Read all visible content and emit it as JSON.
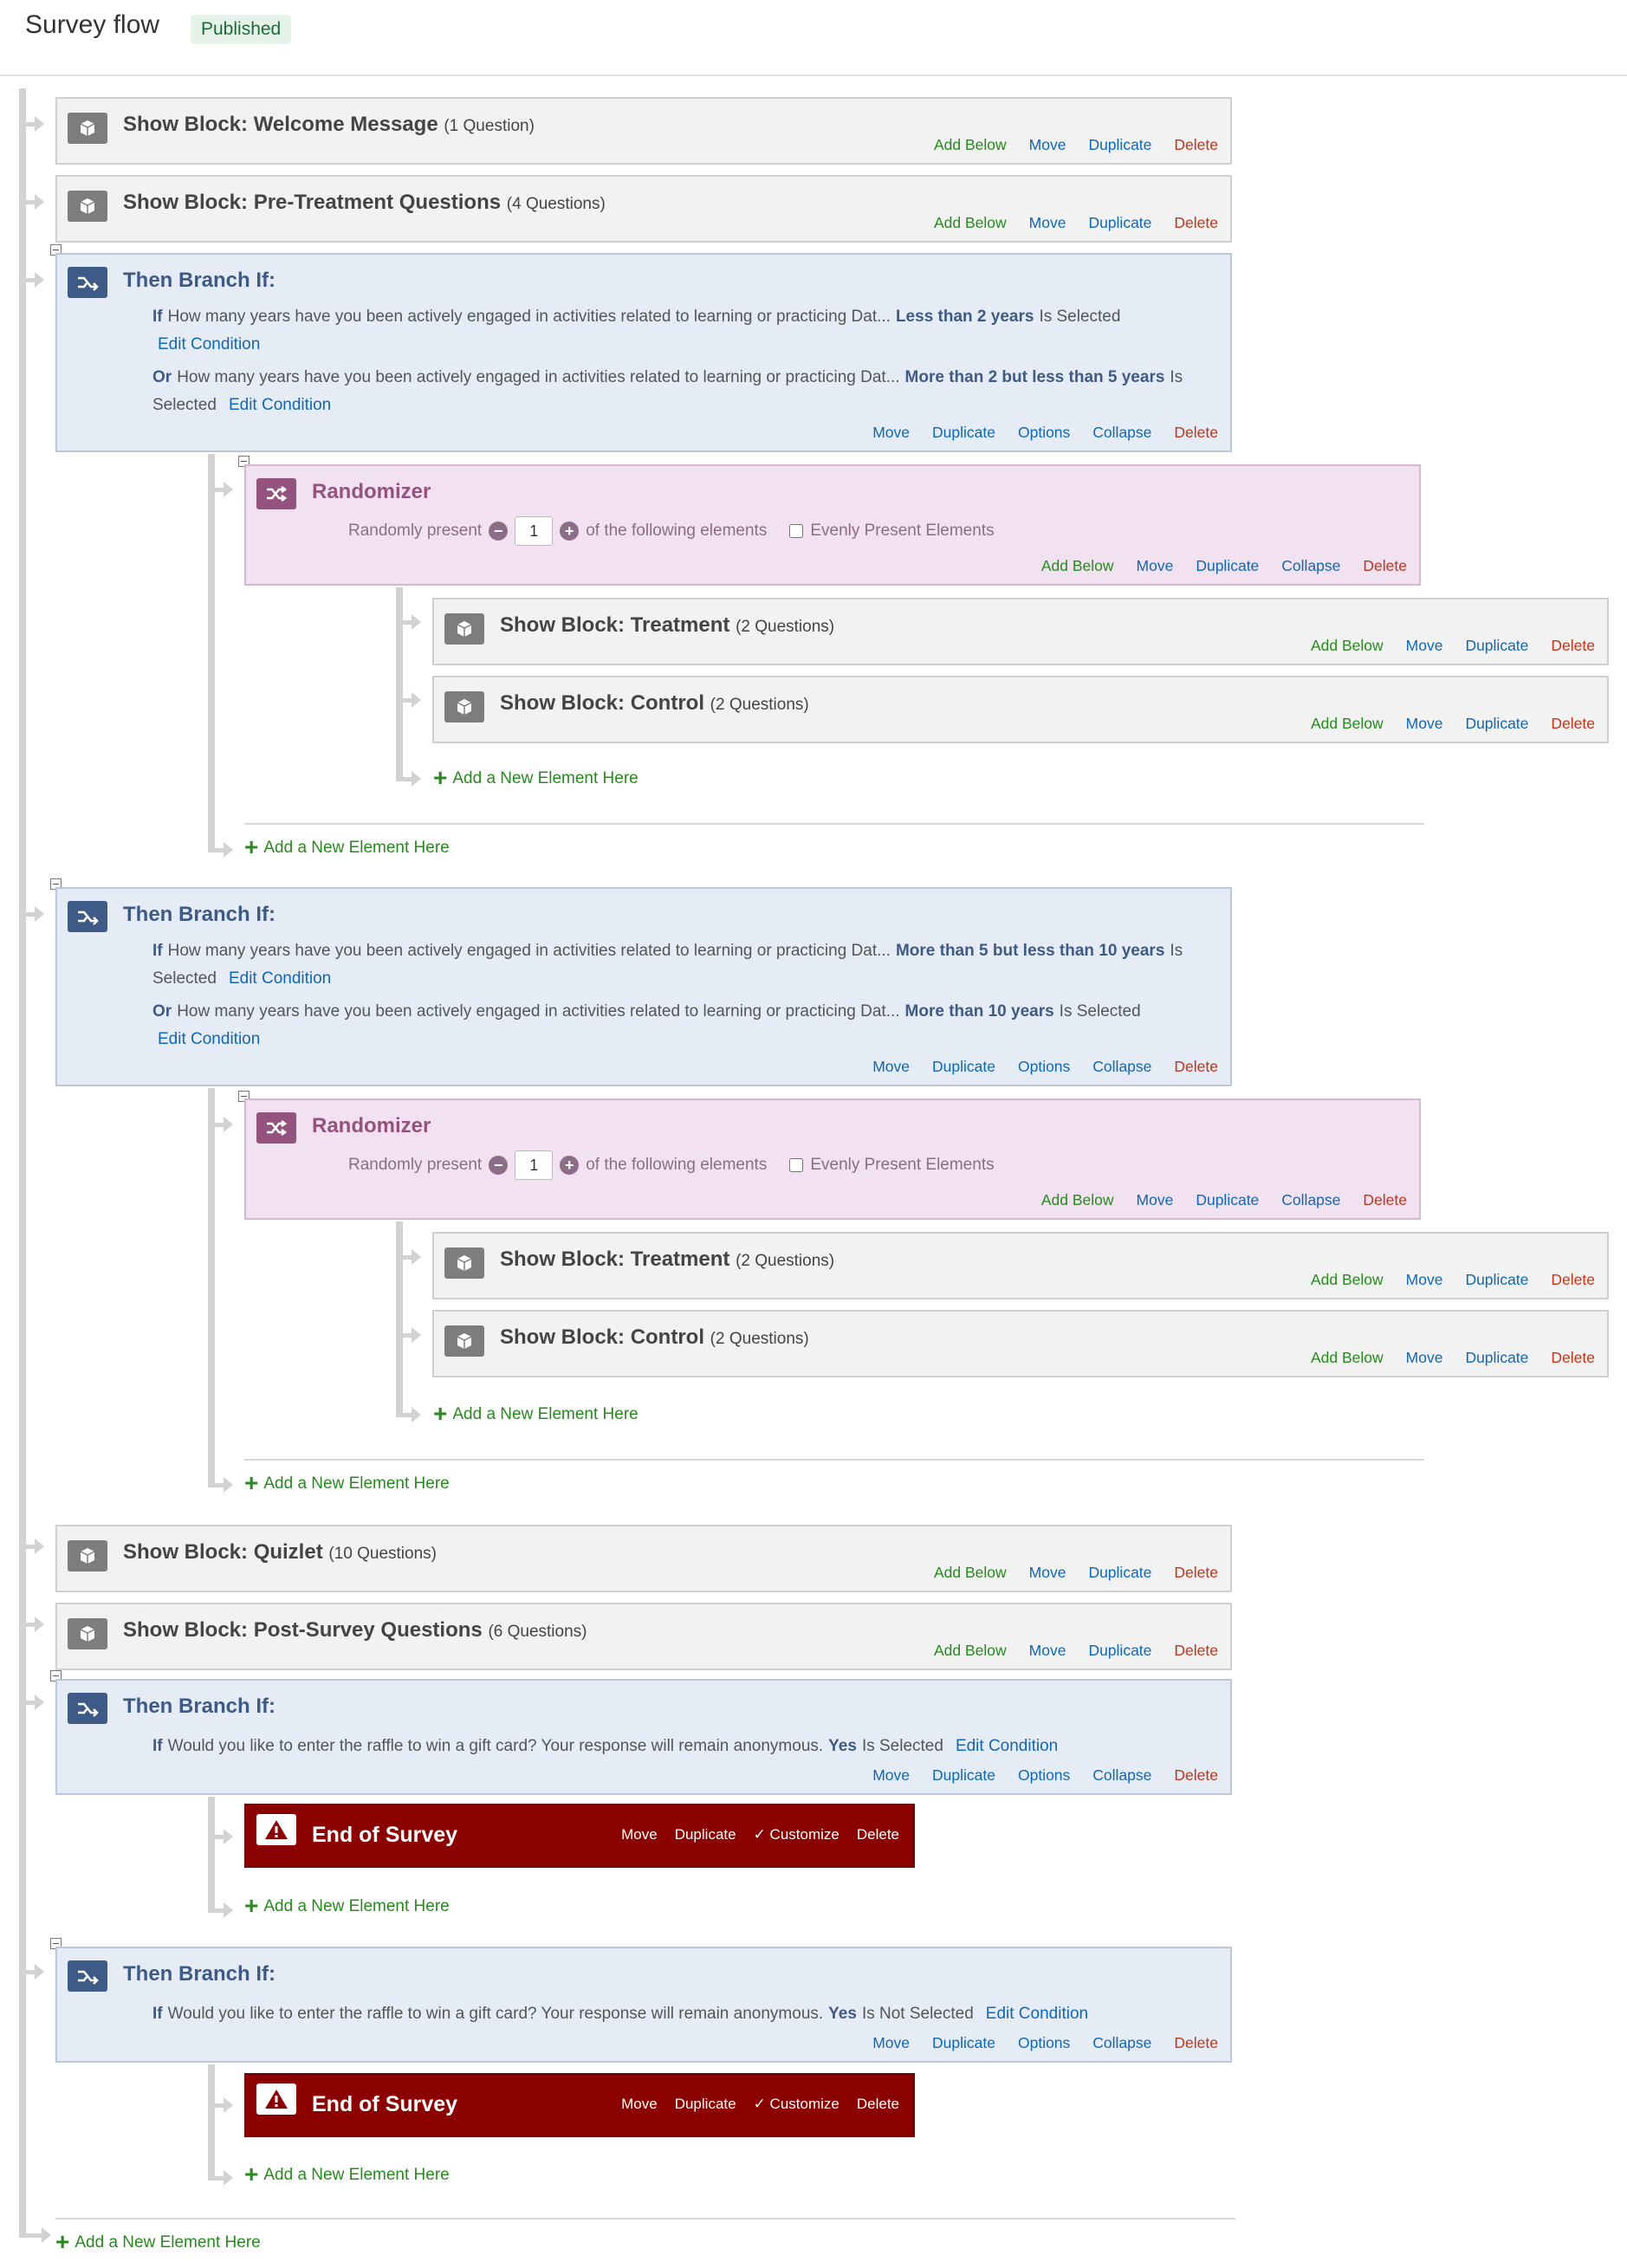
{
  "header": {
    "title": "Survey flow",
    "status": "Published"
  },
  "labels": {
    "add_below": "Add Below",
    "move": "Move",
    "duplicate": "Duplicate",
    "delete": "Delete",
    "options": "Options",
    "collapse": "Collapse",
    "customize": "Customize",
    "edit_condition": "Edit Condition",
    "add_new_element": "Add a New Element Here",
    "then_branch_if": "Then Branch If:",
    "randomizer": "Randomizer",
    "end_of_survey": "End of Survey",
    "show_block": "Show Block:",
    "if": "If",
    "or": "Or",
    "is_selected": "Is Selected",
    "is": "Is",
    "selected": "Selected",
    "is_not_selected": "Is Not Selected",
    "randomly_present": "Randomly present",
    "of_following": "of the following elements",
    "evenly_present": "Evenly Present Elements"
  },
  "blocks": {
    "welcome": {
      "name": "Welcome Message",
      "count": "(1 Question)"
    },
    "pre": {
      "name": "Pre-Treatment Questions",
      "count": "(4 Questions)"
    },
    "treatment": {
      "name": "Treatment",
      "count": "(2 Questions)"
    },
    "control": {
      "name": "Control",
      "count": "(2 Questions)"
    },
    "quizlet": {
      "name": "Quizlet",
      "count": "(10 Questions)"
    },
    "post": {
      "name": "Post-Survey Questions",
      "count": "(6 Questions)"
    }
  },
  "questions": {
    "experience": "How many years have you been actively engaged in activities related to learning or practicing Dat...",
    "raffle": "Would you like to enter the raffle to win a gift card? Your response will remain anonymous."
  },
  "answers": {
    "lt2": "Less than 2 years",
    "2to5": "More than 2 but less than 5 years",
    "5to10": "More than 5 but less than 10 years",
    "gt10": "More than 10 years",
    "yes": "Yes"
  },
  "randomizer": {
    "count_value": "1"
  }
}
